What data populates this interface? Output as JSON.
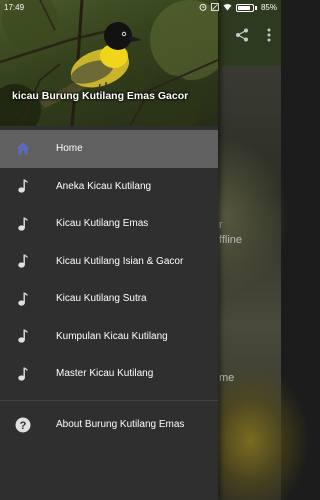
{
  "status_bar": {
    "time": "17:49",
    "battery_percent": "85%",
    "battery_level": 0.85
  },
  "background_app": {
    "fragment_text_1": "r",
    "fragment_text_2": "ffline",
    "fragment_text_3": "me"
  },
  "drawer": {
    "header_title": "kicau Burung Kutilang Emas Gacor",
    "items": [
      {
        "label": "Home",
        "icon": "home-icon",
        "active": true
      },
      {
        "label": "Aneka Kicau Kutilang",
        "icon": "music-note-icon",
        "active": false
      },
      {
        "label": "Kicau Kutilang Emas",
        "icon": "music-note-icon",
        "active": false
      },
      {
        "label": "Kicau Kutilang Isian & Gacor",
        "icon": "music-note-icon",
        "active": false
      },
      {
        "label": "Kicau Kutilang Sutra",
        "icon": "music-note-icon",
        "active": false
      },
      {
        "label": "Kumpulan Kicau Kutilang",
        "icon": "music-note-icon",
        "active": false
      },
      {
        "label": "Master Kicau Kutilang",
        "icon": "music-note-icon",
        "active": false
      }
    ],
    "about": {
      "label": "About Burung Kutilang Emas",
      "icon": "help-circle-icon"
    }
  },
  "colors": {
    "accent_home_icon": "#5c6bc0",
    "drawer_bg": "#2f2f2f",
    "active_item_bg": "#606060"
  }
}
